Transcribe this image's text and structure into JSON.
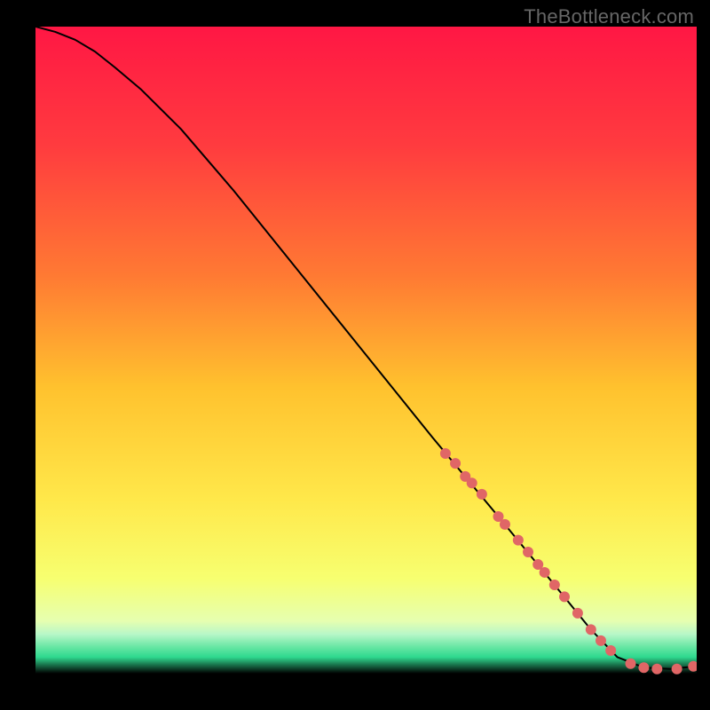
{
  "watermark": "TheBottleneck.com",
  "chart_data": {
    "type": "line",
    "title": "",
    "xlabel": "",
    "ylabel": "",
    "xlim": [
      0,
      100
    ],
    "ylim": [
      0,
      100
    ],
    "background_gradient": {
      "type": "vertical",
      "stops": [
        {
          "pos": 0.0,
          "color": "#ff1744"
        },
        {
          "pos": 0.18,
          "color": "#ff3b3f"
        },
        {
          "pos": 0.38,
          "color": "#ff7a33"
        },
        {
          "pos": 0.55,
          "color": "#ffc22e"
        },
        {
          "pos": 0.72,
          "color": "#ffe84a"
        },
        {
          "pos": 0.84,
          "color": "#f7ff70"
        },
        {
          "pos": 0.905,
          "color": "#e6ffb0"
        },
        {
          "pos": 0.925,
          "color": "#b8f7c8"
        },
        {
          "pos": 0.945,
          "color": "#66e6a3"
        },
        {
          "pos": 0.96,
          "color": "#2fd98f"
        },
        {
          "pos": 0.985,
          "color": "#000000"
        },
        {
          "pos": 1.0,
          "color": "#000000"
        }
      ]
    },
    "series": [
      {
        "name": "bottleneck-curve",
        "color": "#000000",
        "stroke_width": 2,
        "x": [
          0,
          3,
          6,
          9,
          12,
          16,
          22,
          30,
          40,
          50,
          60,
          70,
          78,
          84,
          88,
          92,
          96,
          100
        ],
        "y": [
          100,
          99.2,
          98.0,
          96.2,
          93.8,
          90.4,
          84.4,
          75.0,
          62.5,
          50.0,
          37.5,
          25.4,
          15.6,
          8.2,
          4.0,
          2.4,
          2.2,
          2.6
        ]
      }
    ],
    "points": {
      "name": "highlight-points",
      "color": "#e06666",
      "radius": 6,
      "x": [
        62,
        63.5,
        65,
        66,
        67.5,
        70,
        71,
        73,
        74.5,
        76,
        77,
        78.5,
        80,
        82,
        84,
        85.5,
        87,
        90,
        92,
        94,
        97,
        99.5
      ],
      "y": [
        35,
        33.5,
        31.5,
        30.5,
        28.8,
        25.4,
        24.2,
        21.8,
        20.0,
        18.1,
        16.9,
        15.0,
        13.2,
        10.7,
        8.2,
        6.5,
        5.0,
        3.0,
        2.4,
        2.2,
        2.2,
        2.6
      ]
    }
  }
}
